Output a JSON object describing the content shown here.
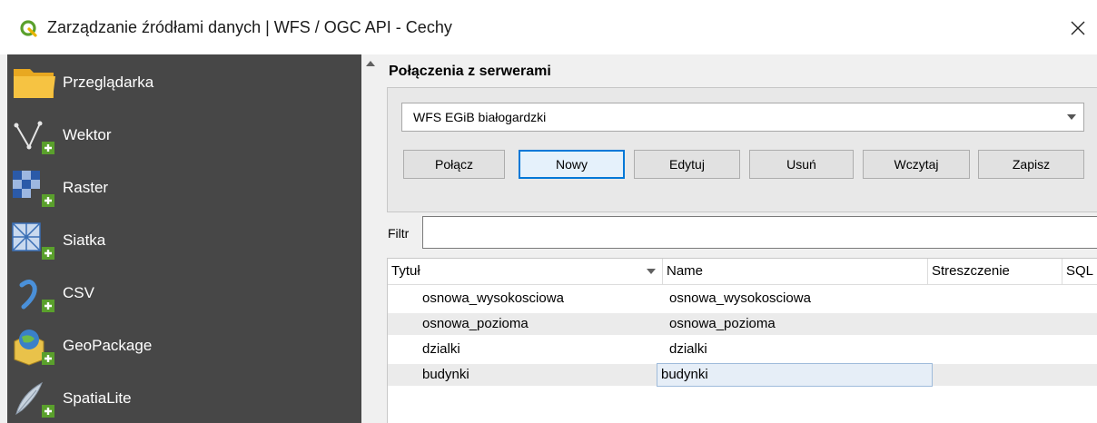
{
  "window": {
    "title": "Zarządzanie źródłami danych | WFS / OGC API - Cechy",
    "logo_icon": "qgis-logo-icon",
    "close_icon": "close-icon"
  },
  "sidebar": {
    "items": [
      {
        "label": "Przeglądarka",
        "icon": "folder-icon"
      },
      {
        "label": "Wektor",
        "icon": "vector-add-icon"
      },
      {
        "label": "Raster",
        "icon": "raster-add-icon"
      },
      {
        "label": "Siatka",
        "icon": "mesh-add-icon"
      },
      {
        "label": "CSV",
        "icon": "csv-add-icon"
      },
      {
        "label": "GeoPackage",
        "icon": "geopackage-add-icon"
      },
      {
        "label": "SpatiaLite",
        "icon": "spatialite-add-icon"
      }
    ]
  },
  "connections": {
    "group_title": "Połączenia z serwerami",
    "selected": "WFS EGiB białogardzki",
    "buttons": {
      "connect": "Połącz",
      "new": "Nowy",
      "edit": "Edytuj",
      "delete": "Usuń",
      "load": "Wczytaj",
      "save": "Zapisz"
    }
  },
  "filter": {
    "label": "Filtr",
    "value": ""
  },
  "table": {
    "columns": [
      "Tytuł",
      "Name",
      "Streszczenie",
      "SQL"
    ],
    "rows": [
      {
        "title": "osnowa_wysokosciowa",
        "name": "osnowa_wysokosciowa"
      },
      {
        "title": "osnowa_pozioma",
        "name": "osnowa_pozioma"
      },
      {
        "title": "dzialki",
        "name": "dzialki"
      },
      {
        "title": "budynki",
        "name": "budynki"
      }
    ]
  },
  "colors": {
    "sidebar_bg": "#474747",
    "accent": "#0078d7",
    "qgis_green": "#5aa02c"
  }
}
